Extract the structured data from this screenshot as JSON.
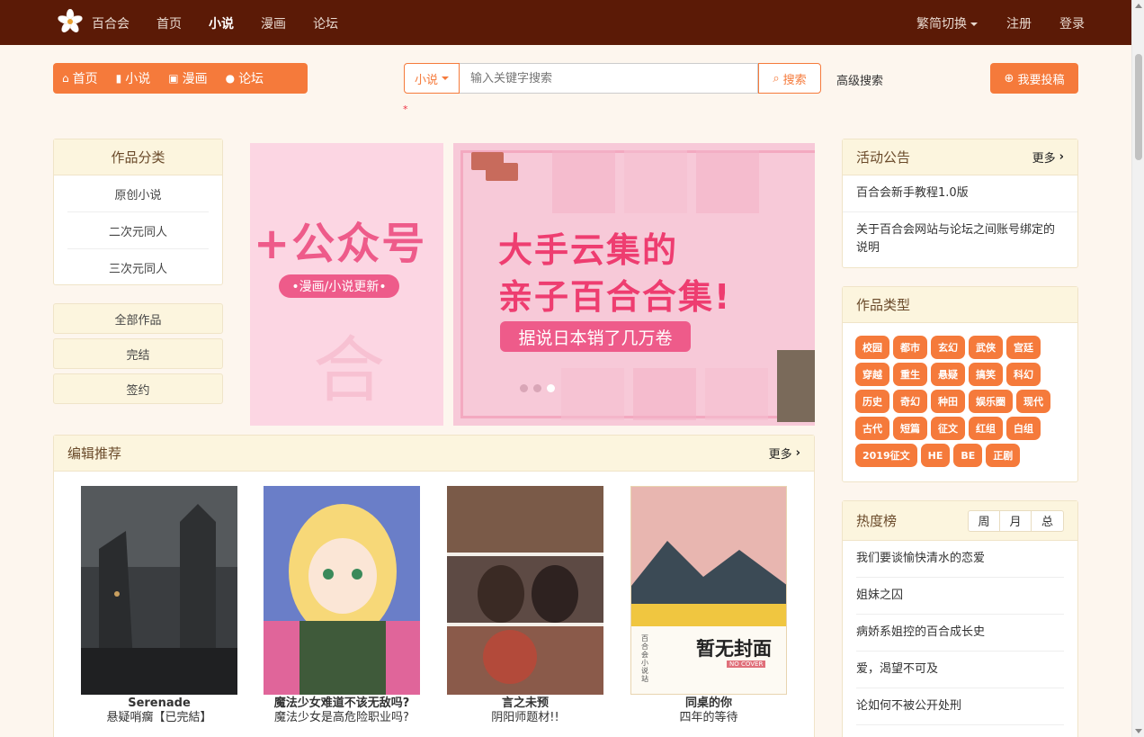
{
  "topnav": {
    "brand": "百合会",
    "links": [
      "首页",
      "小说",
      "漫画",
      "论坛"
    ],
    "active": "小说",
    "lang_switch": "繁简切换",
    "register": "注册",
    "login": "登录"
  },
  "quicknav": [
    "首页",
    "小说",
    "漫画",
    "论坛"
  ],
  "search": {
    "scope": "小说",
    "placeholder": "输入关键字搜索",
    "button": "搜索",
    "advanced": "高级搜索",
    "note": "*"
  },
  "post_button": "我要投稿",
  "categories": {
    "title": "作品分类",
    "items": [
      "原创小说",
      "二次元同人",
      "三次元同人"
    ]
  },
  "filters": [
    "全部作品",
    "完结",
    "签约"
  ],
  "banner": {
    "left_title": "+公众号",
    "left_pill": "•漫画/小说更新•",
    "headline_1": "大手云集的",
    "headline_2": "亲子百合合集!",
    "pill": "据说日本销了几万卷"
  },
  "recommend": {
    "title": "编辑推荐",
    "more": "更多",
    "books": [
      {
        "title": "Serenade",
        "subtitle": "悬疑哨瘸【已完結】"
      },
      {
        "title": "魔法少女难道不该无敌吗?",
        "subtitle": "魔法少女是高危险职业吗?"
      },
      {
        "title": "言之未预",
        "subtitle": "阴阳师题材!!"
      },
      {
        "title": "同桌的你",
        "subtitle": "四年的等待",
        "cover_text": "暂无封面",
        "cover_sub": "NO COVER",
        "cover_side": "百合会小说站"
      }
    ]
  },
  "notice": {
    "title": "活动公告",
    "more": "更多",
    "items": [
      "百合会新手教程1.0版",
      "关于百合会网站与论坛之间账号绑定的说明"
    ]
  },
  "types": {
    "title": "作品类型",
    "tags": [
      "校园",
      "都市",
      "玄幻",
      "武侠",
      "宫廷",
      "穿越",
      "重生",
      "悬疑",
      "搞笑",
      "科幻",
      "历史",
      "奇幻",
      "种田",
      "娱乐圈",
      "现代",
      "古代",
      "短篇",
      "征文",
      "红组",
      "白组",
      "2019征文",
      "HE",
      "BE",
      "正剧"
    ]
  },
  "hot": {
    "title": "热度榜",
    "tabs": [
      "周",
      "月",
      "总"
    ],
    "items": [
      "我们要谈愉快清水的恋爱",
      "姐妹之囚",
      "病娇系姐控的百合成长史",
      "爱，渴望不可及",
      "论如何不被公开处刑"
    ]
  },
  "colors": {
    "nav_bg": "#5b1a06",
    "accent": "#f57a3b",
    "page_bg": "#fdf6ee",
    "panel_head": "#fcf5de"
  }
}
